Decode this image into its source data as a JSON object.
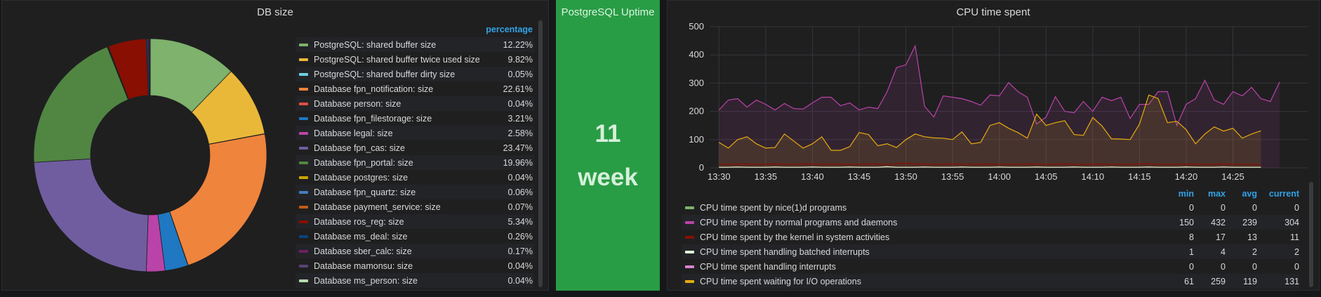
{
  "db_panel": {
    "title": "DB size",
    "legend_header": "percentage",
    "items": [
      {
        "label": "PostgreSQL: shared buffer size",
        "value": "12.22%",
        "color": "#7eb26d"
      },
      {
        "label": "PostgreSQL: shared buffer twice used size",
        "value": "9.82%",
        "color": "#eab839"
      },
      {
        "label": "PostgreSQL: shared buffer dirty size",
        "value": "0.05%",
        "color": "#6ed0e0"
      },
      {
        "label": "Database fpn_notification: size",
        "value": "22.61%",
        "color": "#ef843c"
      },
      {
        "label": "Database person: size",
        "value": "0.04%",
        "color": "#e24d42"
      },
      {
        "label": "Database fpn_filestorage: size",
        "value": "3.21%",
        "color": "#1f78c1"
      },
      {
        "label": "Database legal: size",
        "value": "2.58%",
        "color": "#ba43a9"
      },
      {
        "label": "Database fpn_cas: size",
        "value": "23.47%",
        "color": "#705da0"
      },
      {
        "label": "Database fpn_portal: size",
        "value": "19.96%",
        "color": "#508642"
      },
      {
        "label": "Database postgres: size",
        "value": "0.04%",
        "color": "#cca300"
      },
      {
        "label": "Database fpn_quartz: size",
        "value": "0.06%",
        "color": "#447ebc"
      },
      {
        "label": "Database payment_service: size",
        "value": "0.07%",
        "color": "#c15c17"
      },
      {
        "label": "Database ros_reg: size",
        "value": "5.34%",
        "color": "#890f02"
      },
      {
        "label": "Database ms_deal: size",
        "value": "0.26%",
        "color": "#0a437c"
      },
      {
        "label": "Database sber_calc: size",
        "value": "0.17%",
        "color": "#6d1f62"
      },
      {
        "label": "Database mamonsu: size",
        "value": "0.04%",
        "color": "#584477"
      },
      {
        "label": "Database ms_person: size",
        "value": "0.04%",
        "color": "#b7dbab"
      }
    ]
  },
  "uptime_panel": {
    "title": "PostgreSQL Uptime",
    "value": "11",
    "unit": "week",
    "color": "#299c46"
  },
  "cpu_panel": {
    "title": "CPU time spent",
    "legend_headers": {
      "min": "min",
      "max": "max",
      "avg": "avg",
      "current": "current"
    },
    "legend": [
      {
        "label": "CPU time spent by nice(1)d programs",
        "min": "0",
        "max": "0",
        "avg": "0",
        "current": "0",
        "color": "#7eb26d"
      },
      {
        "label": "CPU time spent by normal programs and daemons",
        "min": "150",
        "max": "432",
        "avg": "239",
        "current": "304",
        "color": "#ba43a9"
      },
      {
        "label": "CPU time spent by the kernel in system activities",
        "min": "8",
        "max": "17",
        "avg": "13",
        "current": "11",
        "color": "#890f02"
      },
      {
        "label": "CPU time spent handling batched interrupts",
        "min": "1",
        "max": "4",
        "avg": "2",
        "current": "2",
        "color": "#e0f9d7"
      },
      {
        "label": "CPU time spent handling interrupts",
        "min": "0",
        "max": "0",
        "avg": "0",
        "current": "0",
        "color": "#d683ce"
      },
      {
        "label": "CPU time spent waiting for I/O operations",
        "min": "61",
        "max": "259",
        "avg": "119",
        "current": "131",
        "color": "#e5ac0e"
      }
    ]
  },
  "chart_data": [
    {
      "type": "pie",
      "title": "DB size",
      "categories": [
        "PostgreSQL: shared buffer size",
        "PostgreSQL: shared buffer twice used size",
        "PostgreSQL: shared buffer dirty size",
        "Database fpn_notification: size",
        "Database person: size",
        "Database fpn_filestorage: size",
        "Database legal: size",
        "Database fpn_cas: size",
        "Database fpn_portal: size",
        "Database postgres: size",
        "Database fpn_quartz: size",
        "Database payment_service: size",
        "Database ros_reg: size",
        "Database ms_deal: size",
        "Database sber_calc: size",
        "Database mamonsu: size",
        "Database ms_person: size"
      ],
      "values": [
        12.22,
        9.82,
        0.05,
        22.61,
        0.04,
        3.21,
        2.58,
        23.47,
        19.96,
        0.04,
        0.06,
        0.07,
        5.34,
        0.26,
        0.17,
        0.04,
        0.04
      ],
      "colors": [
        "#7eb26d",
        "#eab839",
        "#6ed0e0",
        "#ef843c",
        "#e24d42",
        "#1f78c1",
        "#ba43a9",
        "#705da0",
        "#508642",
        "#cca300",
        "#447ebc",
        "#c15c17",
        "#890f02",
        "#0a437c",
        "#6d1f62",
        "#584477",
        "#b7dbab"
      ]
    },
    {
      "type": "line",
      "title": "CPU time spent",
      "ylim": [
        0,
        500
      ],
      "yticks": [
        "0",
        "100",
        "200",
        "300",
        "400",
        "500"
      ],
      "xticks": [
        "13:30",
        "13:35",
        "13:40",
        "13:45",
        "13:50",
        "13:55",
        "14:00",
        "14:05",
        "14:10",
        "14:15",
        "14:20",
        "14:25"
      ],
      "x_start_minutes": 0,
      "x_step_minutes": 1,
      "x_range": [
        -1,
        63
      ],
      "series": [
        {
          "name": "CPU time spent by normal programs and daemons",
          "color": "#ba43a9",
          "values": [
            205,
            240,
            245,
            215,
            240,
            225,
            205,
            228,
            210,
            208,
            230,
            250,
            250,
            220,
            230,
            205,
            215,
            210,
            270,
            355,
            365,
            432,
            218,
            180,
            255,
            250,
            245,
            235,
            222,
            258,
            255,
            302,
            270,
            250,
            155,
            180,
            252,
            200,
            195,
            235,
            200,
            250,
            238,
            250,
            175,
            225,
            225,
            270,
            270,
            150,
            225,
            245,
            310,
            240,
            225,
            270,
            255,
            285,
            245,
            235,
            304
          ]
        },
        {
          "name": "CPU time spent waiting for I/O operations",
          "color": "#e5ac0e",
          "values": [
            90,
            70,
            100,
            110,
            85,
            70,
            72,
            120,
            95,
            70,
            85,
            110,
            62,
            62,
            75,
            125,
            118,
            78,
            85,
            72,
            100,
            120,
            110,
            106,
            105,
            100,
            127,
            85,
            90,
            150,
            160,
            140,
            125,
            105,
            190,
            150,
            160,
            167,
            118,
            115,
            178,
            148,
            103,
            102,
            100,
            155,
            258,
            245,
            160,
            165,
            135,
            85,
            120,
            145,
            130,
            140,
            105,
            120,
            131
          ]
        },
        {
          "name": "CPU time spent by the kernel in system activities",
          "color": "#890f02",
          "values": [
            13,
            12,
            14,
            13,
            12,
            13,
            14,
            12,
            13,
            15,
            13,
            12,
            14,
            13,
            12,
            13,
            14,
            13,
            12,
            15,
            17,
            14,
            13,
            12,
            13,
            14,
            13,
            12,
            13,
            14,
            13,
            12,
            13,
            14,
            13,
            12,
            13,
            14,
            13,
            12,
            13,
            14,
            13,
            12,
            13,
            14,
            15,
            13,
            12,
            13,
            14,
            13,
            12,
            13,
            14,
            13,
            12,
            13,
            11
          ]
        },
        {
          "name": "CPU time spent handling batched interrupts",
          "color": "#e0f9d7",
          "values": [
            2,
            2,
            3,
            2,
            2,
            2,
            3,
            2,
            2,
            2,
            3,
            2,
            2,
            2,
            3,
            2,
            2,
            2,
            4,
            2,
            2,
            2,
            3,
            2,
            2,
            2,
            3,
            2,
            2,
            2,
            3,
            2,
            2,
            2,
            3,
            2,
            2,
            2,
            3,
            2,
            2,
            2,
            3,
            2,
            2,
            2,
            3,
            2,
            2,
            2,
            3,
            2,
            2,
            2,
            3,
            2,
            2,
            2,
            2
          ]
        }
      ]
    }
  ]
}
